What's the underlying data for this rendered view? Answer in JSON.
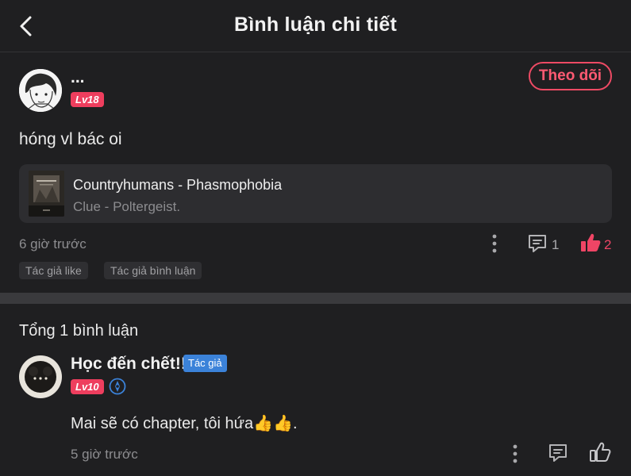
{
  "header": {
    "title": "Bình luận chi tiết",
    "back_icon": "chevron-left-icon"
  },
  "post": {
    "user_name": "...",
    "level": "Lv18",
    "follow_label": "Theo dõi",
    "text": "hóng vl bác oi",
    "story": {
      "title": "Countryhumans - Phasmophobia",
      "subtitle": "Clue - Poltergeist."
    },
    "time": "6 giờ trước",
    "comment_count": "1",
    "like_count": "2",
    "tags": [
      "Tác giả like",
      "Tác giả bình luận"
    ],
    "like_color": "#ef4565"
  },
  "replies": {
    "total_label": "Tổng 1 bình luận",
    "items": [
      {
        "user_name": "Học đến chết!!",
        "author_label": "Tác giả",
        "level": "Lv10",
        "text": "Mai sẽ có chapter, tôi hứa👍👍.",
        "time": "5 giờ trước"
      }
    ]
  },
  "colors": {
    "background": "#1f1f21",
    "accent": "#ee4a64",
    "author_badge": "#3b82d9"
  }
}
